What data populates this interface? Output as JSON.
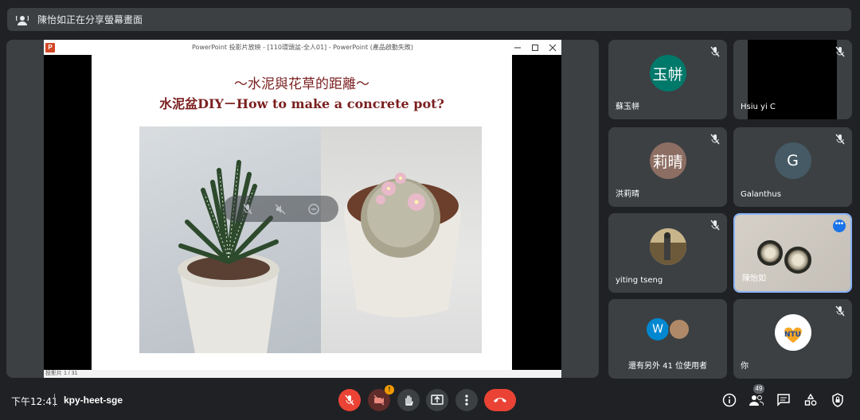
{
  "banner": {
    "text": "陳怡如正在分享螢幕畫面",
    "icon": "presenting-icon"
  },
  "ppt": {
    "window_title": "PowerPoint 投影片放映 - [110環頭盆-全人01] - PowerPoint (產品啟動失敗)",
    "logo_letter": "P",
    "controls": [
      "minimize-icon",
      "maximize-icon",
      "close-icon"
    ],
    "status": "投影片 1 / 31"
  },
  "slide": {
    "title_line1": "～水泥與花草的距離～",
    "title_line2": "水泥盆DIY－How to make a concrete pot?"
  },
  "presenter_overlay": [
    "mic-off-icon",
    "volume-off-icon",
    "remove-icon"
  ],
  "participants": [
    {
      "name": "蘇玉帡",
      "initials": "玉帡",
      "avatar_color": "#00796b",
      "muted": true
    },
    {
      "name": "Hsiu yi C",
      "video": "black",
      "muted": true
    },
    {
      "name": "洪莉晴",
      "initials": "莉晴",
      "avatar_color": "#8d6e63",
      "muted": true
    },
    {
      "name": "Galanthus",
      "initials": "G",
      "avatar_color": "#455a64",
      "muted": true
    },
    {
      "name": "yiting tseng",
      "avatar": "photo",
      "muted": true
    },
    {
      "name": "陳怡如",
      "video": "bowls",
      "active": true
    },
    {
      "name": "還有另外 41 位使用者",
      "initial_w": "W",
      "avatar_color": "#0288d1"
    },
    {
      "name": "你",
      "avatar": "ntu-cares-logo",
      "logo_text": "NTU",
      "muted": true
    }
  ],
  "bottombar": {
    "time": "下午12:41",
    "meeting_code": "kpy-heet-sge",
    "cam_badge": "!",
    "people_count": "49",
    "controls": [
      "mic-off-button",
      "camera-off-button",
      "raise-hand-button",
      "present-button",
      "more-options-button",
      "leave-call-button"
    ],
    "right_controls": [
      "info-button",
      "people-button",
      "chat-button",
      "activities-button",
      "host-controls-button"
    ]
  },
  "colors": {
    "accent": "#8ab4f8",
    "danger": "#ea4335",
    "surface": "#3c4043",
    "background": "#202124",
    "slide_title": "#7b1f1f"
  }
}
